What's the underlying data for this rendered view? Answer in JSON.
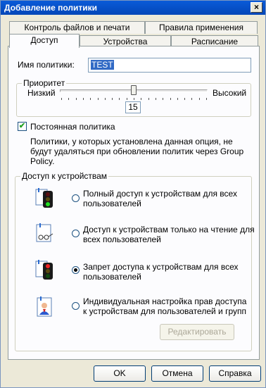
{
  "window": {
    "title": "Добавление политики",
    "close_glyph": "×"
  },
  "tabs": {
    "row1": [
      "Контроль файлов и печати",
      "Правила применения"
    ],
    "row2": [
      "Доступ",
      "Устройства",
      "Расписание"
    ]
  },
  "policy_name": {
    "label": "Имя политики:",
    "value": "TEST"
  },
  "priority": {
    "title": "Приоритет",
    "low_label": "Низкий",
    "high_label": "Высокий",
    "value": "15",
    "level": 0.5
  },
  "permanent": {
    "label": "Постоянная политика",
    "checked": true,
    "description": "Политики, у которых установлена данная опция, не будут удаляться при обновлении политик через Group Policy."
  },
  "device_access": {
    "title": "Доступ к устройствам",
    "options": [
      {
        "line1": "Полный доступ к устройствам для всех",
        "line2": "пользователей",
        "icon": "green-traffic-light-icon",
        "selected": false
      },
      {
        "line1": "Доступ к устройствам только на чтение для",
        "line2": "всех пользователей",
        "icon": "read-only-glasses-icon",
        "selected": false
      },
      {
        "line1": "Запрет доступа к устройствам для всех",
        "line2": "пользователей",
        "icon": "red-traffic-light-icon",
        "selected": true
      },
      {
        "line1": "Индивидуальная настройка прав доступа",
        "line2": "к устройствам для пользователей и групп",
        "icon": "user-card-icon",
        "selected": false
      }
    ],
    "edit_button": "Редактировать"
  },
  "buttons": {
    "ok": "OK",
    "cancel": "Отмена",
    "help": "Справка"
  },
  "colors": {
    "title_bar": "#0a5bd8",
    "selection": "#316ac5",
    "checkmark": "#21a121"
  }
}
